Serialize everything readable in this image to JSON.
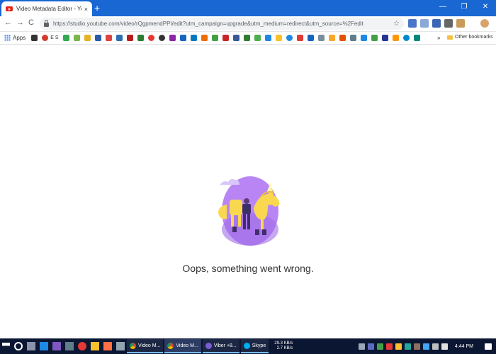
{
  "browser": {
    "tab_title": "Video Metadata Editor - YouTube Studio",
    "tab_close": "×",
    "new_tab": "+",
    "window_controls": {
      "minimize": "—",
      "maximize": "❐",
      "close": "✕"
    },
    "nav": {
      "back": "←",
      "forward": "→",
      "reload": "C"
    },
    "url": "https://studio.youtube.com/video/rQgpmendPPI/edit?utm_campaign=upgrade&utm_medium=redirect&utm_source=%2Fedit",
    "bookmark_star": "☆"
  },
  "bookmarks": {
    "apps_label": "Apps",
    "es_label": "E S",
    "more": "»",
    "other_label": "Other bookmarks"
  },
  "page": {
    "error_message": "Oops, something went wrong."
  },
  "taskbar": {
    "apps": [
      {
        "label": "Video M..."
      },
      {
        "label": "Video M..."
      },
      {
        "label": "Viber +8..."
      },
      {
        "label": "Skype"
      }
    ],
    "net_up": "29.3 KB/s",
    "net_down": "2.7 KB/s",
    "clock": "4:44 PM"
  },
  "colors": {
    "tab_strip": "#1967d2",
    "taskbar": "#0b1633",
    "illustration_purple": "#b985f5",
    "unicorn_yellow": "#f9d84f"
  }
}
